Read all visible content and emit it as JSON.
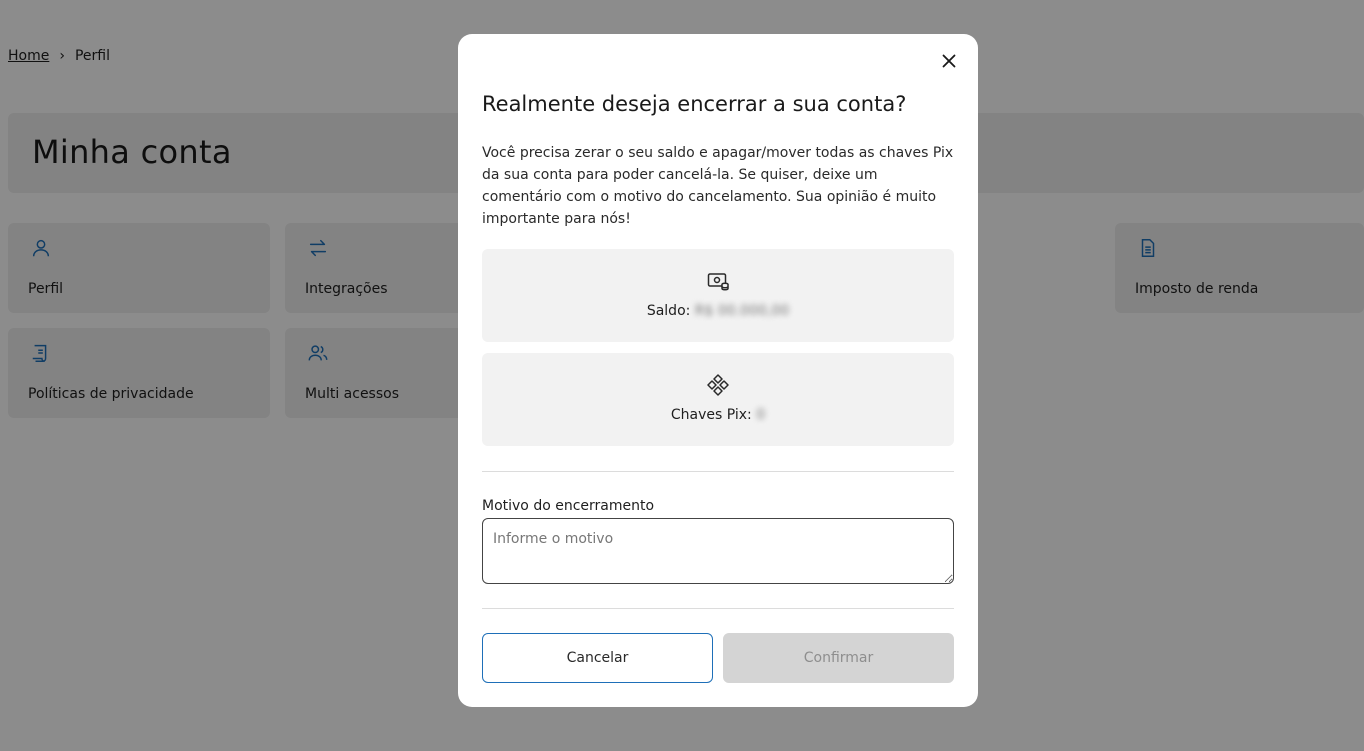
{
  "breadcrumb": {
    "home": "Home",
    "separator": "›",
    "current": "Perfil"
  },
  "page_title": "Minha conta",
  "cards": [
    {
      "label": "Perfil",
      "icon": "user-icon"
    },
    {
      "label": "Integrações",
      "icon": "arrows-swap-icon"
    },
    {
      "label": "Imposto de renda",
      "icon": "document-icon"
    },
    {
      "label": "Políticas de privacidade",
      "icon": "scroll-icon"
    },
    {
      "label": "Multi acessos",
      "icon": "users-icon"
    }
  ],
  "modal": {
    "title": "Realmente deseja encerrar a sua conta?",
    "description": "Você precisa zerar o seu saldo e apagar/mover todas as chaves Pix da sua conta para poder cancelá-la. Se quiser, deixe um comentário com o motivo do cancelamento. Sua opinião é muito importante para nós!",
    "balance_label": "Saldo:",
    "balance_value": "R$ 00.000,00",
    "pix_label": "Chaves Pix:",
    "pix_value": "0",
    "reason_label": "Motivo do encerramento",
    "reason_placeholder": "Informe o motivo",
    "cancel_label": "Cancelar",
    "confirm_label": "Confirmar"
  },
  "colors": {
    "accent": "#1e6fb8",
    "card_bg": "#eeeeee",
    "overlay": "rgba(0,0,0,0.45)",
    "disabled_bg": "#d4d4d4"
  }
}
